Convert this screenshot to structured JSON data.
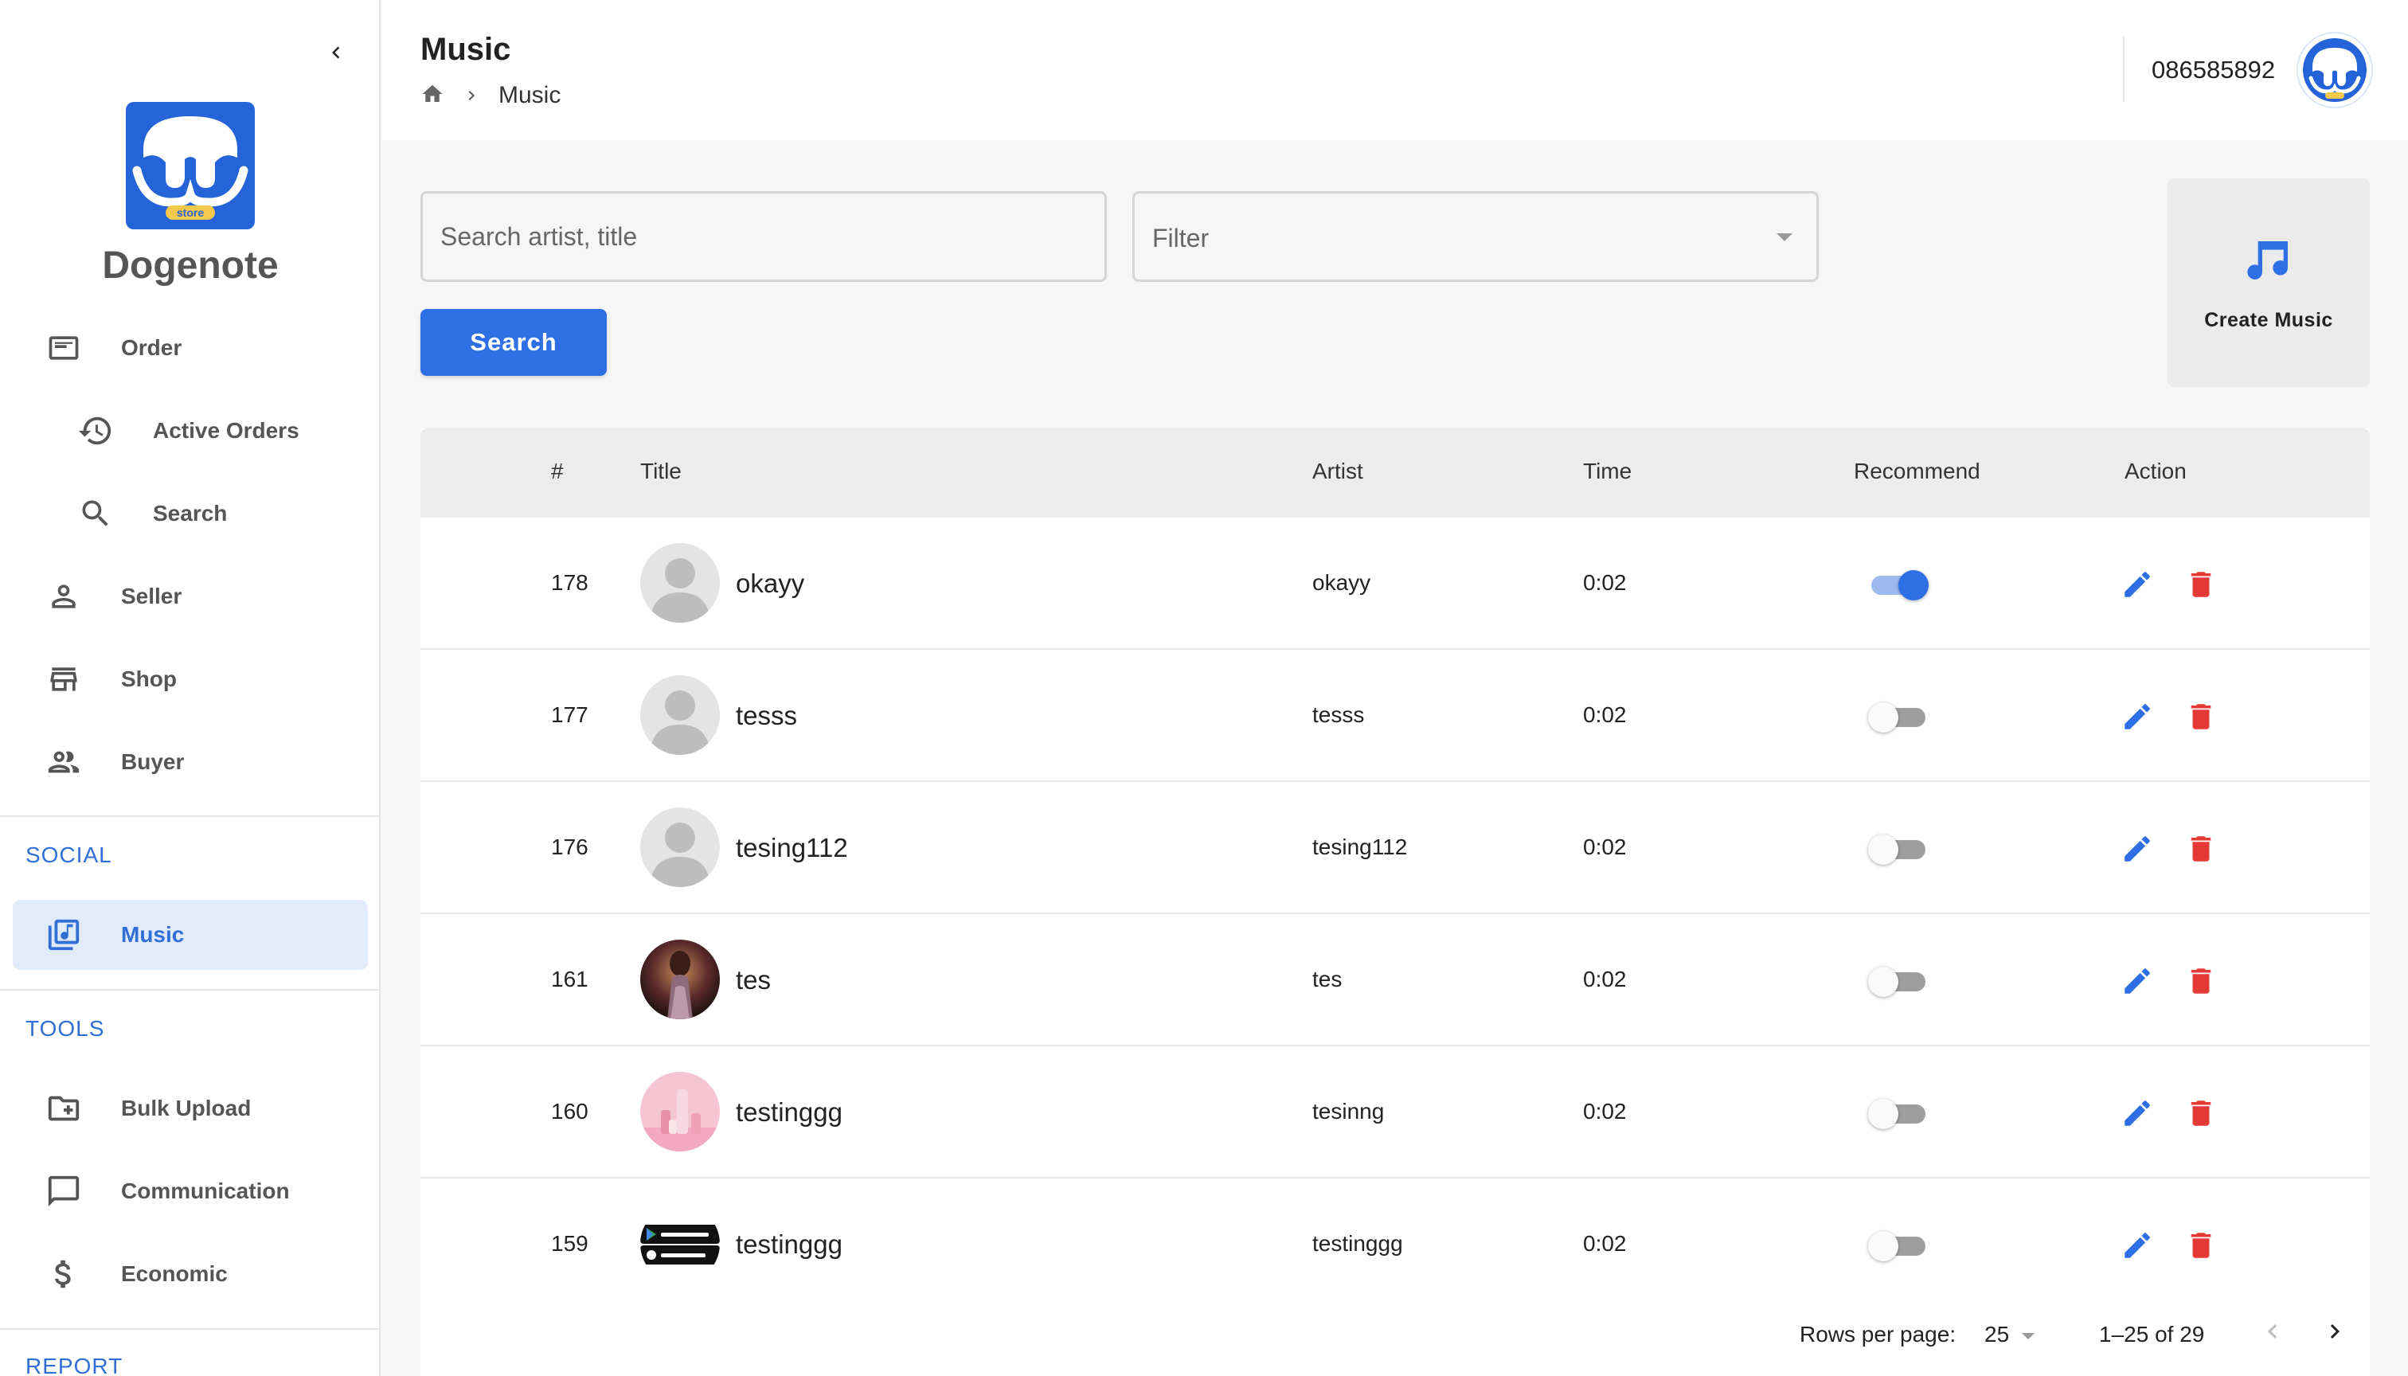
{
  "sidebar": {
    "brand": "Dogenote",
    "logo_badge": "store",
    "items": [
      {
        "label": "Order",
        "icon": "receipt-icon"
      },
      {
        "label": "Active Orders",
        "icon": "history-icon"
      },
      {
        "label": "Search",
        "icon": "search-icon"
      },
      {
        "label": "Seller",
        "icon": "person-icon"
      },
      {
        "label": "Shop",
        "icon": "store-icon"
      },
      {
        "label": "Buyer",
        "icon": "people-icon"
      }
    ],
    "social_section": "SOCIAL",
    "social_items": [
      {
        "label": "Music",
        "icon": "library-music-icon",
        "active": true
      }
    ],
    "tools_section": "TOOLS",
    "tools_items": [
      {
        "label": "Bulk Upload",
        "icon": "folder-plus-icon"
      },
      {
        "label": "Communication",
        "icon": "chat-icon"
      },
      {
        "label": "Economic",
        "icon": "dollar-icon"
      }
    ],
    "report_section": "REPORT"
  },
  "header": {
    "title": "Music",
    "breadcrumb_current": "Music",
    "phone": "086585892"
  },
  "search": {
    "placeholder": "Search artist, title",
    "filter_placeholder": "Filter",
    "button_label": "Search"
  },
  "create": {
    "label": "Create Music"
  },
  "table": {
    "columns": [
      "#",
      "Title",
      "Artist",
      "Time",
      "Recommend",
      "Action"
    ],
    "rows": [
      {
        "id": "178",
        "title": "okayy",
        "artist": "okayy",
        "time": "0:02",
        "recommend": true,
        "thumb": "default-avatar"
      },
      {
        "id": "177",
        "title": "tesss",
        "artist": "tesss",
        "time": "0:02",
        "recommend": false,
        "thumb": "default-avatar"
      },
      {
        "id": "176",
        "title": "tesing112",
        "artist": "tesing112",
        "time": "0:02",
        "recommend": false,
        "thumb": "default-avatar"
      },
      {
        "id": "161",
        "title": "tes",
        "artist": "tes",
        "time": "0:02",
        "recommend": false,
        "thumb": "photo-stage"
      },
      {
        "id": "160",
        "title": "testinggg",
        "artist": "tesinng",
        "time": "0:02",
        "recommend": false,
        "thumb": "photo-pink"
      },
      {
        "id": "159",
        "title": "testinggg",
        "artist": "testinggg",
        "time": "0:02",
        "recommend": false,
        "thumb": "app-badges"
      }
    ]
  },
  "pagination": {
    "rows_per_page_label": "Rows per page:",
    "rows_per_page": "25",
    "range": "1–25 of 29"
  },
  "colors": {
    "accent": "#2f6fe5",
    "delete": "#e53935",
    "active_bg": "#e1ebfb"
  }
}
